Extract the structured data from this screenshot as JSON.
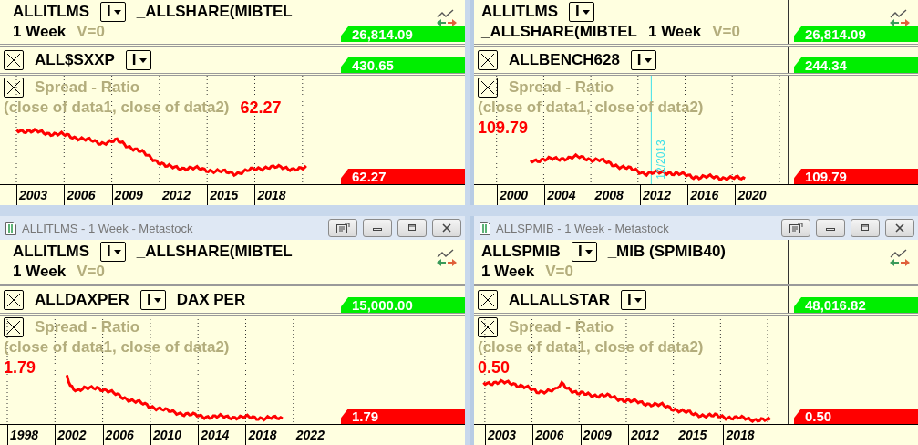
{
  "panes": [
    {
      "header": [
        [
          {
            "kind": "symbol",
            "text": "ALLITLMS"
          },
          {
            "kind": "dropdown",
            "text": "I"
          },
          {
            "kind": "name",
            "text": "_ALLSHARE(MIBTEL"
          }
        ],
        [
          {
            "kind": "interval",
            "text": "1 Week"
          },
          {
            "kind": "volume",
            "text": "V=0"
          }
        ]
      ],
      "sub": [
        [
          {
            "kind": "close"
          },
          {
            "kind": "symbol",
            "text": "ALL$SXXP"
          },
          {
            "kind": "dropdown",
            "text": "I"
          }
        ]
      ],
      "indicator": [
        [
          {
            "kind": "close"
          },
          {
            "kind": "faint",
            "text": "Spread - Ratio"
          }
        ],
        [
          {
            "kind": "faint",
            "text": "(close of data1,  close of data2)"
          },
          {
            "kind": "value",
            "text": "62.27"
          }
        ]
      ],
      "header_tag": {
        "text": "26,814.09",
        "color": "#00ee00"
      },
      "sub_tag": {
        "text": "430.65",
        "color": "#00ee00"
      },
      "indicator_tag": {
        "text": "62.27",
        "color": "#ff0000"
      },
      "years": [
        "2003",
        "2006",
        "2009",
        "2012",
        "2015",
        "2018"
      ]
    },
    {
      "header": [
        [
          {
            "kind": "symbol",
            "text": "ALLITLMS"
          },
          {
            "kind": "dropdown",
            "text": "I"
          }
        ],
        [
          {
            "kind": "name",
            "text": "_ALLSHARE(MIBTEL"
          },
          {
            "kind": "interval",
            "text": "1 Week"
          },
          {
            "kind": "volume",
            "text": "V=0"
          }
        ]
      ],
      "sub": [
        [
          {
            "kind": "close"
          },
          {
            "kind": "symbol",
            "text": "ALLBENCH628"
          },
          {
            "kind": "dropdown",
            "text": "I"
          }
        ]
      ],
      "indicator": [
        [
          {
            "kind": "close"
          },
          {
            "kind": "faint",
            "text": "Spread - Ratio"
          }
        ],
        [
          {
            "kind": "faint",
            "text": "(close of data1,  close of data2)"
          }
        ],
        [
          {
            "kind": "value",
            "text": "109.79"
          }
        ]
      ],
      "header_tag": {
        "text": "26,814.09",
        "color": "#00ee00"
      },
      "sub_tag": {
        "text": "244.34",
        "color": "#00ee00"
      },
      "indicator_tag": {
        "text": "109.79",
        "color": "#ff0000"
      },
      "marker": {
        "text": "12/2013"
      },
      "years": [
        "2000",
        "2004",
        "2008",
        "2012",
        "2016",
        "2020"
      ]
    },
    {
      "title": "ALLITLMS - 1 Week - Metastock",
      "header": [
        [
          {
            "kind": "symbol",
            "text": "ALLITLMS"
          },
          {
            "kind": "dropdown",
            "text": "I"
          },
          {
            "kind": "name",
            "text": "_ALLSHARE(MIBTEL"
          }
        ],
        [
          {
            "kind": "interval",
            "text": "1 Week"
          },
          {
            "kind": "volume",
            "text": "V=0"
          }
        ]
      ],
      "sub": [
        [
          {
            "kind": "close"
          },
          {
            "kind": "symbol",
            "text": "ALLDAXPER"
          },
          {
            "kind": "dropdown",
            "text": "I"
          },
          {
            "kind": "name",
            "text": "DAX PER"
          }
        ]
      ],
      "indicator": [
        [
          {
            "kind": "close"
          },
          {
            "kind": "faint",
            "text": "Spread - Ratio"
          }
        ],
        [
          {
            "kind": "faint",
            "text": "(close of data1,  close of data2)"
          }
        ],
        [
          {
            "kind": "value",
            "text": "1.79"
          }
        ]
      ],
      "sub_tag": {
        "text": "15,000.00",
        "color": "#00ee00"
      },
      "indicator_tag": {
        "text": "1.79",
        "color": "#ff0000"
      },
      "years": [
        "1998",
        "2002",
        "2006",
        "2010",
        "2014",
        "2018",
        "2022"
      ]
    },
    {
      "title": "ALLSPMIB - 1 Week - Metastock",
      "header": [
        [
          {
            "kind": "symbol",
            "text": "ALLSPMIB"
          },
          {
            "kind": "dropdown",
            "text": "I"
          },
          {
            "kind": "name",
            "text": "_MIB (SPMIB40)"
          }
        ],
        [
          {
            "kind": "interval",
            "text": "1 Week"
          },
          {
            "kind": "volume",
            "text": "V=0"
          }
        ]
      ],
      "sub": [
        [
          {
            "kind": "close"
          },
          {
            "kind": "symbol",
            "text": "ALLALLSTAR"
          },
          {
            "kind": "dropdown",
            "text": "I"
          }
        ]
      ],
      "indicator": [
        [
          {
            "kind": "close"
          },
          {
            "kind": "faint",
            "text": "Spread - Ratio"
          }
        ],
        [
          {
            "kind": "faint",
            "text": "(close of data1,  close of data2)"
          }
        ],
        [
          {
            "kind": "value",
            "text": "0.50"
          }
        ]
      ],
      "sub_tag": {
        "text": "48,016.82",
        "color": "#00ee00"
      },
      "indicator_tag": {
        "text": "0.50",
        "color": "#ff0000"
      },
      "years": [
        "2003",
        "2006",
        "2009",
        "2012",
        "2015",
        "2018"
      ]
    }
  ]
}
